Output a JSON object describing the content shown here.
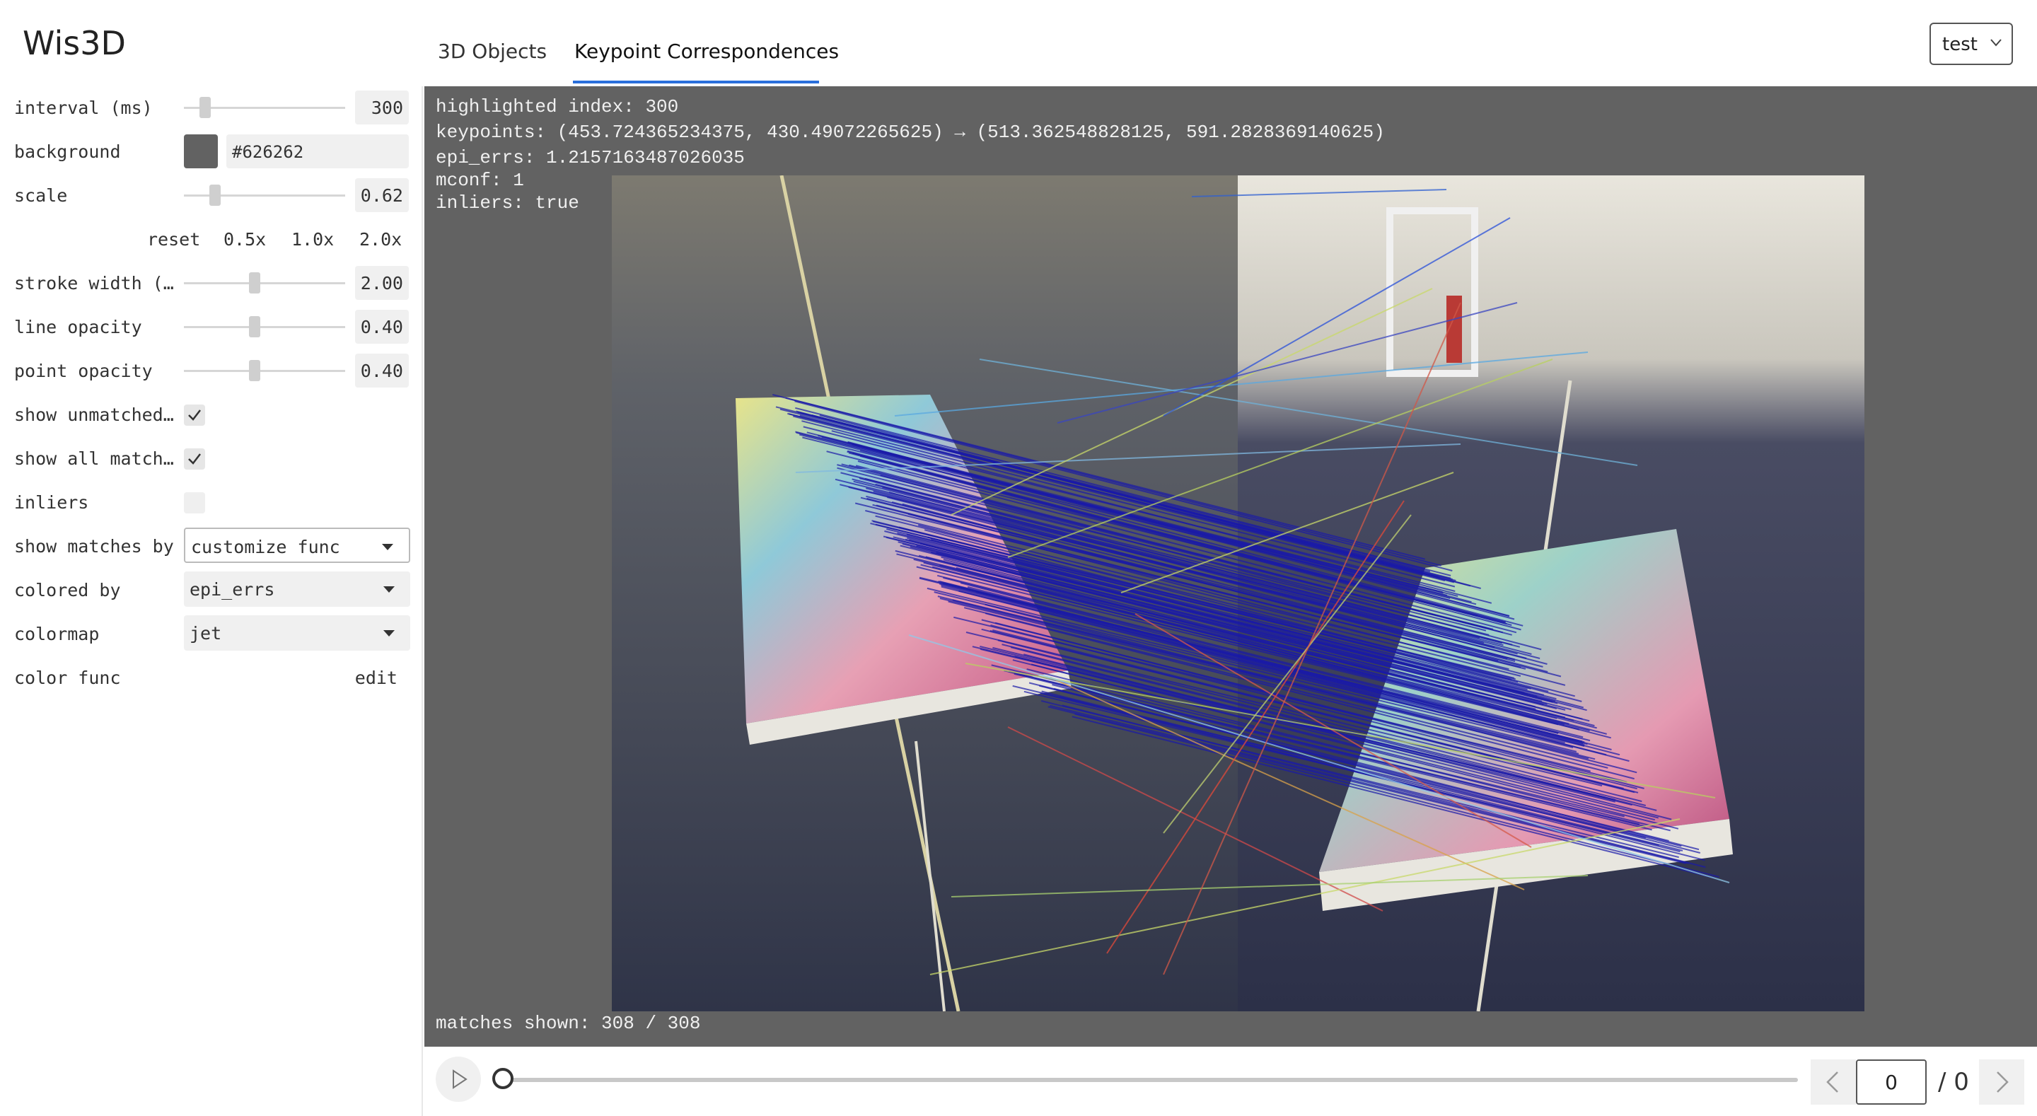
{
  "app": {
    "title": "Wis3D"
  },
  "tabs": [
    {
      "label": "3D Objects"
    },
    {
      "label": "Keypoint Correspondences"
    }
  ],
  "scene_select": {
    "value": "test"
  },
  "controls": {
    "interval": {
      "label": "interval (ms)",
      "value": "300",
      "slider_fraction": 0.08
    },
    "background": {
      "label": "background",
      "value": "#626262",
      "swatch_color": "#626262"
    },
    "scale": {
      "label": "scale",
      "value": "0.62",
      "slider_fraction": 0.14
    },
    "scale_buttons": [
      "reset",
      "0.5x",
      "1.0x",
      "2.0x"
    ],
    "stroke_width": {
      "label": "stroke width (…",
      "value": "2.00",
      "slider_fraction": 0.42
    },
    "line_opacity": {
      "label": "line opacity",
      "value": "0.40",
      "slider_fraction": 0.42
    },
    "point_opacity": {
      "label": "point opacity",
      "value": "0.40",
      "slider_fraction": 0.42
    },
    "show_unmatched": {
      "label": "show unmatched…",
      "checked": true
    },
    "show_all_matches": {
      "label": "show all match…",
      "checked": true
    },
    "inliers": {
      "label": "inliers",
      "checked": false
    },
    "show_matches_by": {
      "label": "show matches by",
      "value": "customize func"
    },
    "colored_by": {
      "label": "colored by",
      "value": "epi_errs"
    },
    "colormap": {
      "label": "colormap",
      "value": "jet"
    },
    "color_func": {
      "label": "color func",
      "action": "edit"
    }
  },
  "viewer": {
    "background": "#626262",
    "highlighted": "highlighted index: 300",
    "keypoints": "keypoints: (453.724365234375, 430.49072265625) → (513.362548828125, 591.2828369140625)",
    "epi_errs": "epi_errs: 1.2157163487026035",
    "mconf": "mconf: 1",
    "inliers": "inliers: true",
    "matches_shown": "matches shown: 308 / 308"
  },
  "playback": {
    "frame_value": "0",
    "frame_total": "/ 0",
    "progress_fraction": 0
  }
}
